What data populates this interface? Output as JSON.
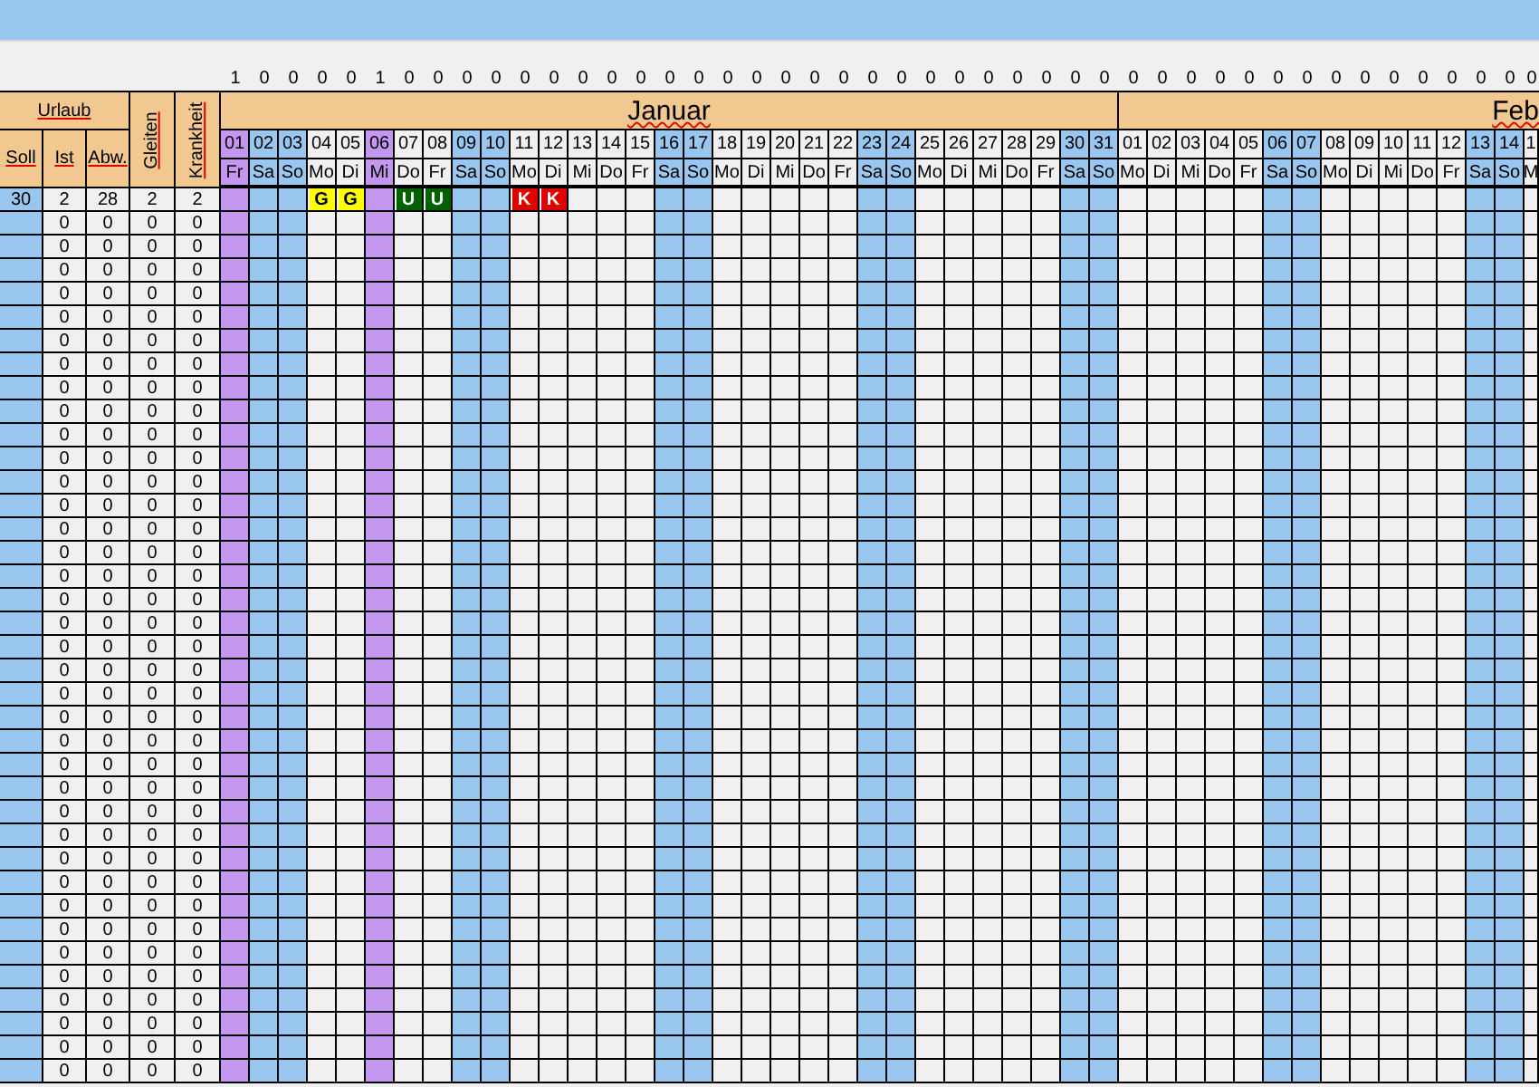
{
  "header": {
    "urlaub": "Urlaub",
    "soll": "Soll",
    "ist": "Ist",
    "abw": "Abw.",
    "gleiten": "Gleiten",
    "krankheit": "Krankheit"
  },
  "months": [
    {
      "name": "Januar",
      "days": [
        {
          "day": "01",
          "weekday": "Fr",
          "flag": "1",
          "kind": "holiday"
        },
        {
          "day": "02",
          "weekday": "Sa",
          "flag": "0",
          "kind": "weekend"
        },
        {
          "day": "03",
          "weekday": "So",
          "flag": "0",
          "kind": "weekend"
        },
        {
          "day": "04",
          "weekday": "Mo",
          "flag": "0",
          "kind": "workday"
        },
        {
          "day": "05",
          "weekday": "Di",
          "flag": "0",
          "kind": "workday"
        },
        {
          "day": "06",
          "weekday": "Mi",
          "flag": "1",
          "kind": "holiday"
        },
        {
          "day": "07",
          "weekday": "Do",
          "flag": "0",
          "kind": "workday"
        },
        {
          "day": "08",
          "weekday": "Fr",
          "flag": "0",
          "kind": "workday"
        },
        {
          "day": "09",
          "weekday": "Sa",
          "flag": "0",
          "kind": "weekend"
        },
        {
          "day": "10",
          "weekday": "So",
          "flag": "0",
          "kind": "weekend"
        },
        {
          "day": "11",
          "weekday": "Mo",
          "flag": "0",
          "kind": "workday"
        },
        {
          "day": "12",
          "weekday": "Di",
          "flag": "0",
          "kind": "workday"
        },
        {
          "day": "13",
          "weekday": "Mi",
          "flag": "0",
          "kind": "workday"
        },
        {
          "day": "14",
          "weekday": "Do",
          "flag": "0",
          "kind": "workday"
        },
        {
          "day": "15",
          "weekday": "Fr",
          "flag": "0",
          "kind": "workday"
        },
        {
          "day": "16",
          "weekday": "Sa",
          "flag": "0",
          "kind": "weekend"
        },
        {
          "day": "17",
          "weekday": "So",
          "flag": "0",
          "kind": "weekend"
        },
        {
          "day": "18",
          "weekday": "Mo",
          "flag": "0",
          "kind": "workday"
        },
        {
          "day": "19",
          "weekday": "Di",
          "flag": "0",
          "kind": "workday"
        },
        {
          "day": "20",
          "weekday": "Mi",
          "flag": "0",
          "kind": "workday"
        },
        {
          "day": "21",
          "weekday": "Do",
          "flag": "0",
          "kind": "workday"
        },
        {
          "day": "22",
          "weekday": "Fr",
          "flag": "0",
          "kind": "workday"
        },
        {
          "day": "23",
          "weekday": "Sa",
          "flag": "0",
          "kind": "weekend"
        },
        {
          "day": "24",
          "weekday": "So",
          "flag": "0",
          "kind": "weekend"
        },
        {
          "day": "25",
          "weekday": "Mo",
          "flag": "0",
          "kind": "workday"
        },
        {
          "day": "26",
          "weekday": "Di",
          "flag": "0",
          "kind": "workday"
        },
        {
          "day": "27",
          "weekday": "Mi",
          "flag": "0",
          "kind": "workday"
        },
        {
          "day": "28",
          "weekday": "Do",
          "flag": "0",
          "kind": "workday"
        },
        {
          "day": "29",
          "weekday": "Fr",
          "flag": "0",
          "kind": "workday"
        },
        {
          "day": "30",
          "weekday": "Sa",
          "flag": "0",
          "kind": "weekend"
        },
        {
          "day": "31",
          "weekday": "So",
          "flag": "0",
          "kind": "weekend"
        }
      ]
    },
    {
      "name": "Feb",
      "days": [
        {
          "day": "01",
          "weekday": "Mo",
          "flag": "0",
          "kind": "workday"
        },
        {
          "day": "02",
          "weekday": "Di",
          "flag": "0",
          "kind": "workday"
        },
        {
          "day": "03",
          "weekday": "Mi",
          "flag": "0",
          "kind": "workday"
        },
        {
          "day": "04",
          "weekday": "Do",
          "flag": "0",
          "kind": "workday"
        },
        {
          "day": "05",
          "weekday": "Fr",
          "flag": "0",
          "kind": "workday"
        },
        {
          "day": "06",
          "weekday": "Sa",
          "flag": "0",
          "kind": "weekend"
        },
        {
          "day": "07",
          "weekday": "So",
          "flag": "0",
          "kind": "weekend"
        },
        {
          "day": "08",
          "weekday": "Mo",
          "flag": "0",
          "kind": "workday"
        },
        {
          "day": "09",
          "weekday": "Di",
          "flag": "0",
          "kind": "workday"
        },
        {
          "day": "10",
          "weekday": "Mi",
          "flag": "0",
          "kind": "workday"
        },
        {
          "day": "11",
          "weekday": "Do",
          "flag": "0",
          "kind": "workday"
        },
        {
          "day": "12",
          "weekday": "Fr",
          "flag": "0",
          "kind": "workday"
        },
        {
          "day": "13",
          "weekday": "Sa",
          "flag": "0",
          "kind": "weekend"
        },
        {
          "day": "14",
          "weekday": "So",
          "flag": "0",
          "kind": "weekend"
        },
        {
          "day": "1",
          "weekday": "M",
          "flag": "0",
          "kind": "workday"
        }
      ]
    }
  ],
  "rows": [
    {
      "soll": "30",
      "ist": "2",
      "abw": "28",
      "gleiten": "2",
      "krankheit": "2",
      "cells": [
        null,
        null,
        null,
        {
          "code": "G",
          "color": "#ffff00"
        },
        {
          "code": "G",
          "color": "#ffff00"
        },
        null,
        {
          "code": "U",
          "color": "#006100"
        },
        {
          "code": "U",
          "color": "#006100"
        },
        null,
        null,
        {
          "code": "K",
          "color": "#e00000"
        },
        {
          "code": "K",
          "color": "#e00000"
        }
      ]
    },
    {
      "ist": "0",
      "abw": "0",
      "gleiten": "0",
      "krankheit": "0"
    },
    {
      "ist": "0",
      "abw": "0",
      "gleiten": "0",
      "krankheit": "0"
    },
    {
      "ist": "0",
      "abw": "0",
      "gleiten": "0",
      "krankheit": "0"
    },
    {
      "ist": "0",
      "abw": "0",
      "gleiten": "0",
      "krankheit": "0"
    },
    {
      "ist": "0",
      "abw": "0",
      "gleiten": "0",
      "krankheit": "0"
    },
    {
      "ist": "0",
      "abw": "0",
      "gleiten": "0",
      "krankheit": "0"
    },
    {
      "ist": "0",
      "abw": "0",
      "gleiten": "0",
      "krankheit": "0"
    },
    {
      "ist": "0",
      "abw": "0",
      "gleiten": "0",
      "krankheit": "0"
    },
    {
      "ist": "0",
      "abw": "0",
      "gleiten": "0",
      "krankheit": "0"
    },
    {
      "ist": "0",
      "abw": "0",
      "gleiten": "0",
      "krankheit": "0"
    },
    {
      "ist": "0",
      "abw": "0",
      "gleiten": "0",
      "krankheit": "0"
    },
    {
      "ist": "0",
      "abw": "0",
      "gleiten": "0",
      "krankheit": "0"
    },
    {
      "ist": "0",
      "abw": "0",
      "gleiten": "0",
      "krankheit": "0"
    },
    {
      "ist": "0",
      "abw": "0",
      "gleiten": "0",
      "krankheit": "0"
    },
    {
      "ist": "0",
      "abw": "0",
      "gleiten": "0",
      "krankheit": "0"
    },
    {
      "ist": "0",
      "abw": "0",
      "gleiten": "0",
      "krankheit": "0"
    },
    {
      "ist": "0",
      "abw": "0",
      "gleiten": "0",
      "krankheit": "0"
    },
    {
      "ist": "0",
      "abw": "0",
      "gleiten": "0",
      "krankheit": "0"
    },
    {
      "ist": "0",
      "abw": "0",
      "gleiten": "0",
      "krankheit": "0"
    },
    {
      "ist": "0",
      "abw": "0",
      "gleiten": "0",
      "krankheit": "0"
    },
    {
      "ist": "0",
      "abw": "0",
      "gleiten": "0",
      "krankheit": "0"
    },
    {
      "ist": "0",
      "abw": "0",
      "gleiten": "0",
      "krankheit": "0"
    },
    {
      "ist": "0",
      "abw": "0",
      "gleiten": "0",
      "krankheit": "0"
    },
    {
      "ist": "0",
      "abw": "0",
      "gleiten": "0",
      "krankheit": "0"
    },
    {
      "ist": "0",
      "abw": "0",
      "gleiten": "0",
      "krankheit": "0"
    },
    {
      "ist": "0",
      "abw": "0",
      "gleiten": "0",
      "krankheit": "0"
    },
    {
      "ist": "0",
      "abw": "0",
      "gleiten": "0",
      "krankheit": "0"
    },
    {
      "ist": "0",
      "abw": "0",
      "gleiten": "0",
      "krankheit": "0"
    },
    {
      "ist": "0",
      "abw": "0",
      "gleiten": "0",
      "krankheit": "0"
    },
    {
      "ist": "0",
      "abw": "0",
      "gleiten": "0",
      "krankheit": "0"
    },
    {
      "ist": "0",
      "abw": "0",
      "gleiten": "0",
      "krankheit": "0"
    },
    {
      "ist": "0",
      "abw": "0",
      "gleiten": "0",
      "krankheit": "0"
    },
    {
      "ist": "0",
      "abw": "0",
      "gleiten": "0",
      "krankheit": "0"
    },
    {
      "ist": "0",
      "abw": "0",
      "gleiten": "0",
      "krankheit": "0"
    },
    {
      "ist": "0",
      "abw": "0",
      "gleiten": "0",
      "krankheit": "0"
    },
    {
      "ist": "0",
      "abw": "0",
      "gleiten": "0",
      "krankheit": "0"
    },
    {
      "ist": "0",
      "abw": "0",
      "gleiten": "0",
      "krankheit": "0"
    }
  ]
}
